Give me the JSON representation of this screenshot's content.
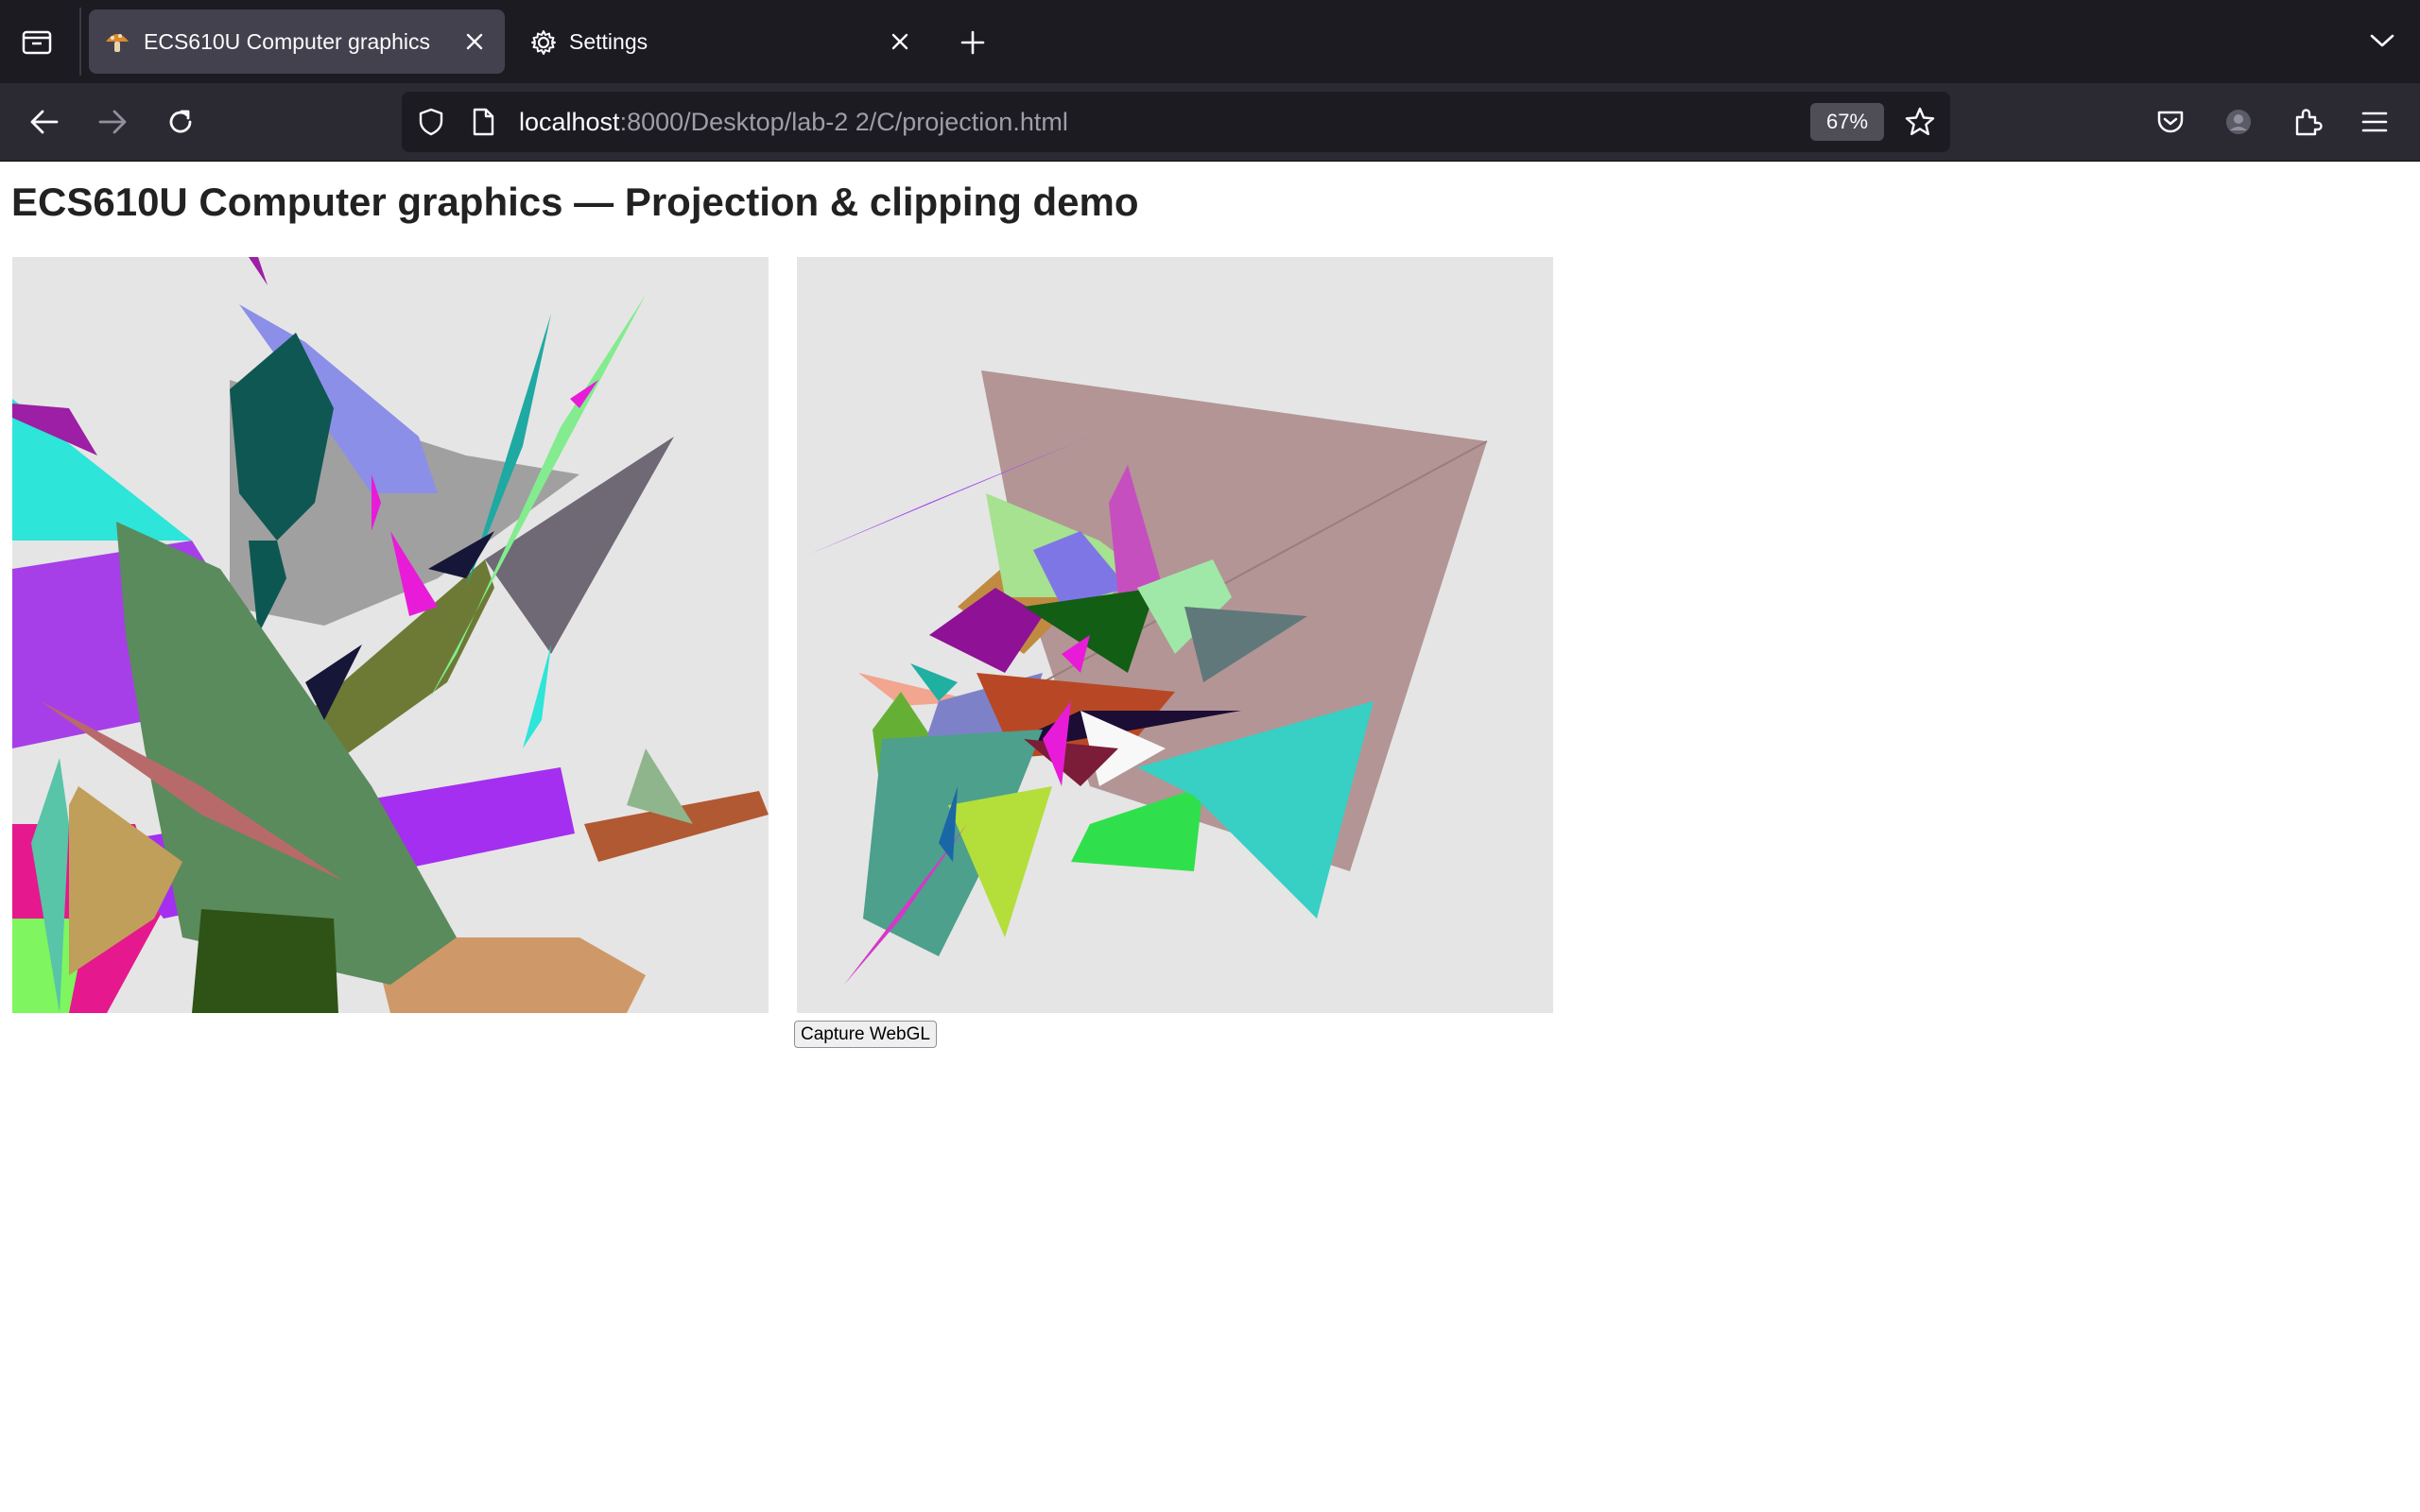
{
  "browser": {
    "tabs": [
      {
        "title": "ECS610U Computer graphics",
        "active": true,
        "favicon": "mushroom-icon"
      },
      {
        "title": "Settings",
        "active": false,
        "favicon": "gear-icon"
      }
    ],
    "url": {
      "host": "localhost",
      "rest": ":8000/Desktop/lab-2 2/C/projection.html"
    },
    "zoom": "67%",
    "colors": {
      "tabbar": "#1c1b22",
      "toolbar": "#2b2a33",
      "urlbar": "#1c1b22",
      "active_tab": "#42414d"
    }
  },
  "page": {
    "title": "ECS610U Computer graphics — Projection & clipping demo",
    "capture_button": "Capture WebGL",
    "canvas_background": "#e5e5e5"
  }
}
